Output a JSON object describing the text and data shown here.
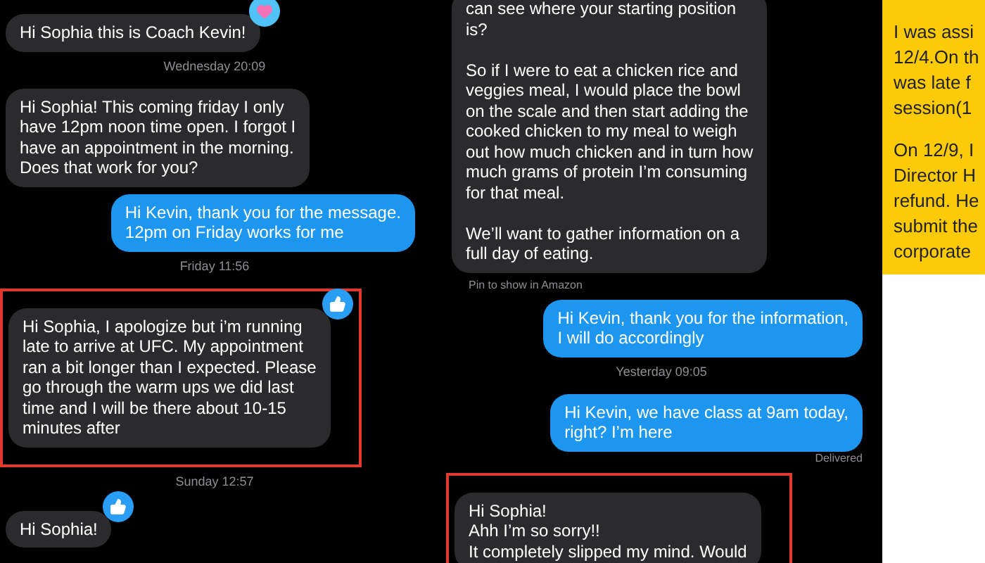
{
  "panels": [
    {
      "kind": "chat",
      "items": [
        {
          "kind": "message",
          "outgoing": false,
          "text": "Hi Sophia this is Coach Kevin!",
          "highlighted": false,
          "reaction": {
            "kind": "heart"
          }
        },
        {
          "kind": "timestamp",
          "text": "Wednesday 20:09"
        },
        {
          "kind": "message",
          "outgoing": false,
          "text": "Hi Sophia! This coming friday I only\nhave 12pm noon time open. I forgot I\nhave an appointment in the morning.\nDoes that work for you?",
          "highlighted": false
        },
        {
          "kind": "message",
          "outgoing": true,
          "text": "Hi Kevin, thank you for the message.\n12pm on Friday works for me",
          "highlighted": false
        },
        {
          "kind": "timestamp",
          "text": "Friday 11:56"
        },
        {
          "kind": "message",
          "outgoing": false,
          "text": "Hi Sophia, I apologize but i’m running\nlate to arrive at UFC. My appointment\nran a bit longer than I expected. Please\ngo through the warm ups we did last\ntime and I will be there about 10-15\nminutes after",
          "highlighted": true,
          "reaction": {
            "kind": "thumbs_up"
          }
        },
        {
          "kind": "timestamp",
          "text": "Sunday 12:57"
        },
        {
          "kind": "message",
          "outgoing": false,
          "text": "Hi Sophia!",
          "highlighted": false,
          "reaction": {
            "kind": "thumbs_up"
          }
        }
      ]
    },
    {
      "kind": "chat",
      "items": [
        {
          "kind": "message",
          "outgoing": false,
          "text": "can see where your starting position\nis?\n\nSo if I were to eat a chicken rice and\nveggies meal, I would place the bowl\non the scale and then start adding the\ncooked chicken to my meal to weigh\nout how much chicken and in turn how\nmuch grams of protein I’m consuming\nfor that meal.\n\nWe’ll want to gather information on a\nfull day of eating.",
          "highlighted": false
        },
        {
          "kind": "note",
          "text": "Pin to show in Amazon"
        },
        {
          "kind": "message",
          "outgoing": true,
          "text": "Hi Kevin, thank you for the information,\nI will do accordingly",
          "highlighted": false
        },
        {
          "kind": "timestamp",
          "text": "Yesterday 09:05"
        },
        {
          "kind": "message",
          "outgoing": true,
          "text": "Hi Kevin, we have class at 9am today,\nright? I’m here",
          "highlighted": false
        },
        {
          "kind": "status",
          "text": "Delivered"
        },
        {
          "kind": "message",
          "outgoing": false,
          "text": "Hi Sophia!\nAhh I’m  so sorry!!\nIt completely slipped my mind. Would",
          "highlighted": true
        }
      ]
    },
    {
      "kind": "card",
      "paragraphs": [
        {
          "lines": [
            "I was assi",
            "12/4.On th",
            "was late f",
            "session(1"
          ]
        },
        {
          "lines": [
            "On 12/9, I",
            "Director  H",
            "refund. He",
            "submit the",
            "corporate"
          ]
        }
      ]
    }
  ]
}
